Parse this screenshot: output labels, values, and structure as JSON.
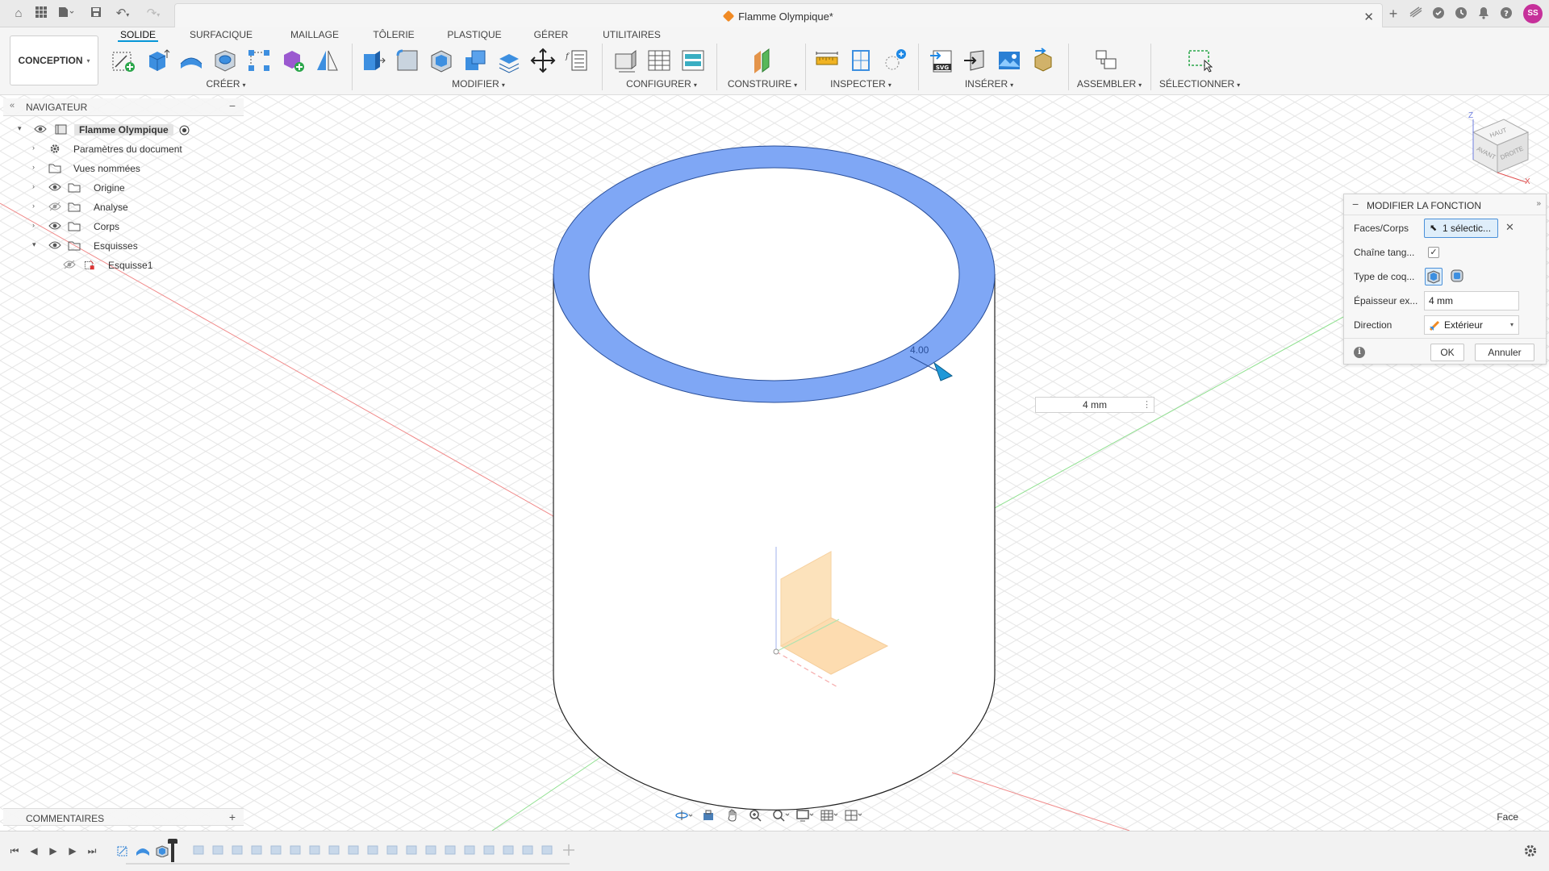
{
  "window": {
    "document_title": "Flamme Olympique*",
    "user_initials": "SS"
  },
  "ribbon": {
    "workspace": "CONCEPTION",
    "tabs": [
      {
        "label": "SOLIDE",
        "active": true
      },
      {
        "label": "SURFACIQUE",
        "active": false
      },
      {
        "label": "MAILLAGE",
        "active": false
      },
      {
        "label": "TÔLERIE",
        "active": false
      },
      {
        "label": "PLASTIQUE",
        "active": false
      },
      {
        "label": "GÉRER",
        "active": false
      },
      {
        "label": "UTILITAIRES",
        "active": false
      }
    ],
    "groups": {
      "create": "CRÉER",
      "modify": "MODIFIER",
      "configure": "CONFIGURER",
      "construct": "CONSTRUIRE",
      "inspect": "INSPECTER",
      "insert": "INSÉRER",
      "assemble": "ASSEMBLER",
      "select": "SÉLECTIONNER"
    }
  },
  "navigator": {
    "title": "NAVIGATEUR",
    "items": [
      {
        "label": "Flamme Olympique",
        "icon": "component-icon"
      },
      {
        "label": "Paramètres du document",
        "icon": "gear-icon"
      },
      {
        "label": "Vues nommées",
        "icon": "folder-icon"
      },
      {
        "label": "Origine",
        "icon": "folder-icon"
      },
      {
        "label": "Analyse",
        "icon": "folder-icon"
      },
      {
        "label": "Corps",
        "icon": "folder-icon"
      },
      {
        "label": "Esquisses",
        "icon": "folder-icon"
      },
      {
        "label": "Esquisse1",
        "icon": "sketch-icon"
      }
    ]
  },
  "shell_panel": {
    "title": "MODIFIER LA FONCTION",
    "faces_label": "Faces/Corps",
    "faces_value": "1 sélectic...",
    "chain_label": "Chaîne tang...",
    "chain_checked": "✓",
    "shell_type_label": "Type de coq...",
    "thickness_label": "Épaisseur ex...",
    "thickness_value": "4 mm",
    "direction_label": "Direction",
    "direction_value": "Extérieur",
    "ok": "OK",
    "cancel": "Annuler"
  },
  "viewport": {
    "float_input": "4 mm",
    "ring_dimension": "4.00",
    "accent_color": "#7fa7f5"
  },
  "viewcube": {
    "top": "HAUT",
    "front": "AVANT",
    "right": "DROITE",
    "axis_z": "Z",
    "axis_x": "X"
  },
  "comments": {
    "title": "COMMENTAIRES"
  },
  "status": {
    "selection_filter": "Face"
  }
}
